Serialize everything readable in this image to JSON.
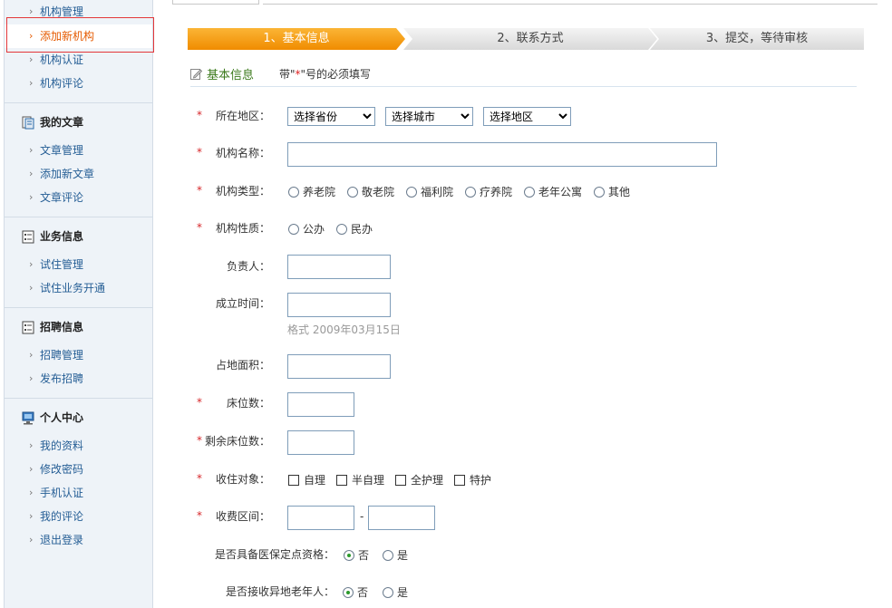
{
  "sidebar": {
    "org_items": [
      {
        "label": "机构管理"
      },
      {
        "label": "添加新机构"
      },
      {
        "label": "机构认证"
      },
      {
        "label": "机构评论"
      }
    ],
    "articles": {
      "title": "我的文章",
      "items": [
        {
          "label": "文章管理"
        },
        {
          "label": "添加新文章"
        },
        {
          "label": "文章评论"
        }
      ]
    },
    "business": {
      "title": "业务信息",
      "items": [
        {
          "label": "试住管理"
        },
        {
          "label": "试住业务开通"
        }
      ]
    },
    "recruit": {
      "title": "招聘信息",
      "items": [
        {
          "label": "招聘管理"
        },
        {
          "label": "发布招聘"
        }
      ]
    },
    "personal": {
      "title": "个人中心",
      "items": [
        {
          "label": "我的资料"
        },
        {
          "label": "修改密码"
        },
        {
          "label": "手机认证"
        },
        {
          "label": "我的评论"
        },
        {
          "label": "退出登录"
        }
      ]
    },
    "chevron": "›"
  },
  "steps": [
    "1、基本信息",
    "2、联系方式",
    "3、提交，等待审核"
  ],
  "section": {
    "title": "基本信息",
    "note_prefix": "带\"",
    "note_star": "*",
    "note_suffix": "\"号的必须填写"
  },
  "form": {
    "required_mark": "*",
    "region": {
      "label": "所在地区：",
      "province": "选择省份",
      "city": "选择城市",
      "district": "选择地区"
    },
    "name": {
      "label": "机构名称："
    },
    "type": {
      "label": "机构类型：",
      "options": [
        "养老院",
        "敬老院",
        "福利院",
        "疗养院",
        "老年公寓",
        "其他"
      ]
    },
    "nature": {
      "label": "机构性质：",
      "options": [
        "公办",
        "民办"
      ]
    },
    "manager": {
      "label": "负责人："
    },
    "founded": {
      "label": "成立时间：",
      "hint": "格式 2009年03月15日"
    },
    "area": {
      "label": "占地面积："
    },
    "beds": {
      "label": "床位数："
    },
    "remaining_beds": {
      "label": "剩余床位数："
    },
    "accept": {
      "label": "收住对象：",
      "options": [
        "自理",
        "半自理",
        "全护理",
        "特护"
      ]
    },
    "fee": {
      "label": "收费区间：",
      "separator": "-"
    },
    "insurance": {
      "label": "是否具备医保定点资格：",
      "options": [
        "否",
        "是"
      ],
      "selected": "否"
    },
    "remote_elderly": {
      "label": "是否接收异地老年人：",
      "options": [
        "否",
        "是"
      ],
      "selected": "否"
    }
  }
}
